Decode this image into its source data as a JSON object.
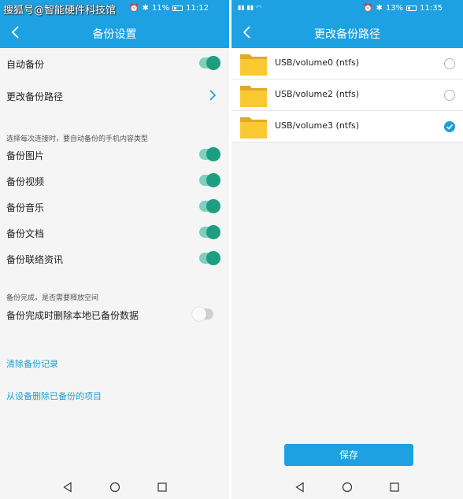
{
  "watermark": "搜狐号@智能硬件科技馆",
  "left": {
    "status": {
      "battery": "11%",
      "time": "11:12"
    },
    "title": "备份设置",
    "auto_backup": {
      "label": "自动备份",
      "enabled": true
    },
    "change_path": {
      "label": "更改备份路径"
    },
    "types_hint": "选择每次连接时，要自动备份的手机内容类型",
    "types": [
      {
        "label": "备份图片",
        "enabled": true
      },
      {
        "label": "备份视频",
        "enabled": true
      },
      {
        "label": "备份音乐",
        "enabled": true
      },
      {
        "label": "备份文档",
        "enabled": true
      },
      {
        "label": "备份联络资讯",
        "enabled": true
      }
    ],
    "free_hint": "备份完成，是否需要释放空间",
    "delete_local": {
      "label": "备份完成时删除本地已备份数据",
      "enabled": false
    },
    "clear_records": "清除备份记录",
    "delete_from_device": "从设备删除已备份的项目"
  },
  "right": {
    "status": {
      "battery": "13%",
      "time": "11:35"
    },
    "title": "更改备份路径",
    "volumes": [
      {
        "name": "USB/volume0 (ntfs)",
        "selected": false
      },
      {
        "name": "USB/volume2 (ntfs)",
        "selected": false
      },
      {
        "name": "USB/volume3 (ntfs)",
        "selected": true
      }
    ],
    "save_label": "保存"
  },
  "colors": {
    "accent": "#1da1e2",
    "toggle_on": "#1d9e80",
    "link": "#1d9ed8",
    "folder": "#f8c931"
  },
  "icons": [
    "back-arrow-icon",
    "chevron-right-icon",
    "folder-icon",
    "check-icon",
    "nav-back-icon",
    "nav-home-icon",
    "nav-recents-icon",
    "alarm-icon",
    "bluetooth-icon",
    "battery-icon",
    "wifi-icon",
    "signal-icon"
  ]
}
